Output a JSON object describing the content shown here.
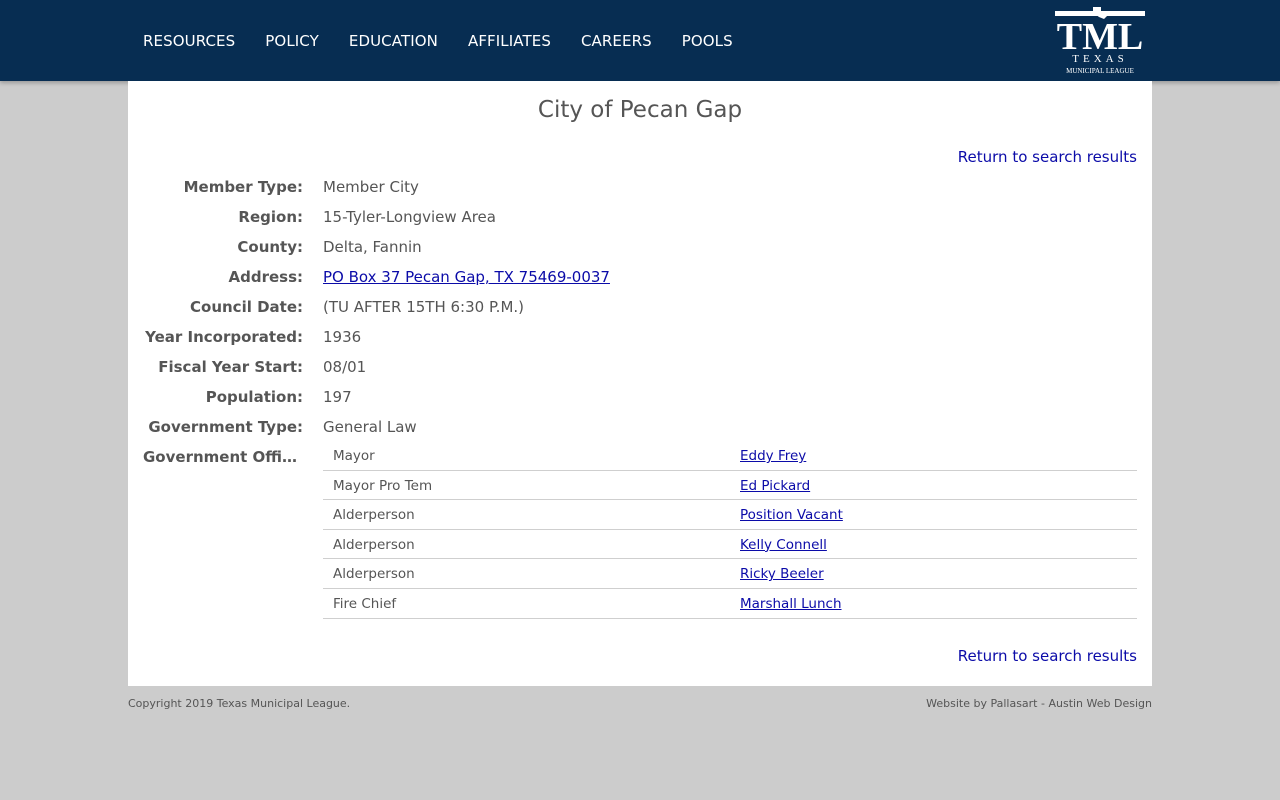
{
  "nav": {
    "items": [
      "RESOURCES",
      "POLICY",
      "EDUCATION",
      "AFFILIATES",
      "CAREERS",
      "POOLS"
    ]
  },
  "logo": {
    "main": "TML",
    "line1": "TEXAS",
    "line2": "MUNICIPAL LEAGUE"
  },
  "page": {
    "title": "City of Pecan Gap",
    "return_label": "Return to search results"
  },
  "details": [
    {
      "label": "Member Type:",
      "value": "Member City"
    },
    {
      "label": "Region:",
      "value": "15-Tyler-Longview Area"
    },
    {
      "label": "County:",
      "value": "Delta, Fannin"
    },
    {
      "label": "Address:",
      "value": "PO Box 37 Pecan Gap, TX 75469-0037"
    },
    {
      "label": "Council Date:",
      "value": "(TU AFTER 15TH 6:30 P.M.)"
    },
    {
      "label": "Year Incorporated:",
      "value": "1936"
    },
    {
      "label": "Fiscal Year Start:",
      "value": "08/01"
    },
    {
      "label": "Population:",
      "value": "197"
    },
    {
      "label": "Government Type:",
      "value": "General Law"
    }
  ],
  "officials": {
    "label": "Government Officials:",
    "rows": [
      {
        "position": "Mayor",
        "name": "Eddy Frey"
      },
      {
        "position": "Mayor Pro Tem",
        "name": "Ed Pickard"
      },
      {
        "position": "Alderperson",
        "name": "Position Vacant"
      },
      {
        "position": "Alderperson",
        "name": "Kelly Connell"
      },
      {
        "position": "Alderperson",
        "name": "Ricky Beeler"
      },
      {
        "position": "Fire Chief",
        "name": "Marshall Lunch"
      }
    ]
  },
  "footer": {
    "copyright": "Copyright 2019 Texas Municipal League.",
    "credit": "Website by Pallasart - Austin Web Design"
  },
  "colors": {
    "header_bg": "#072d52",
    "link": "#0b0ba8",
    "page_bg": "#cccccc"
  }
}
